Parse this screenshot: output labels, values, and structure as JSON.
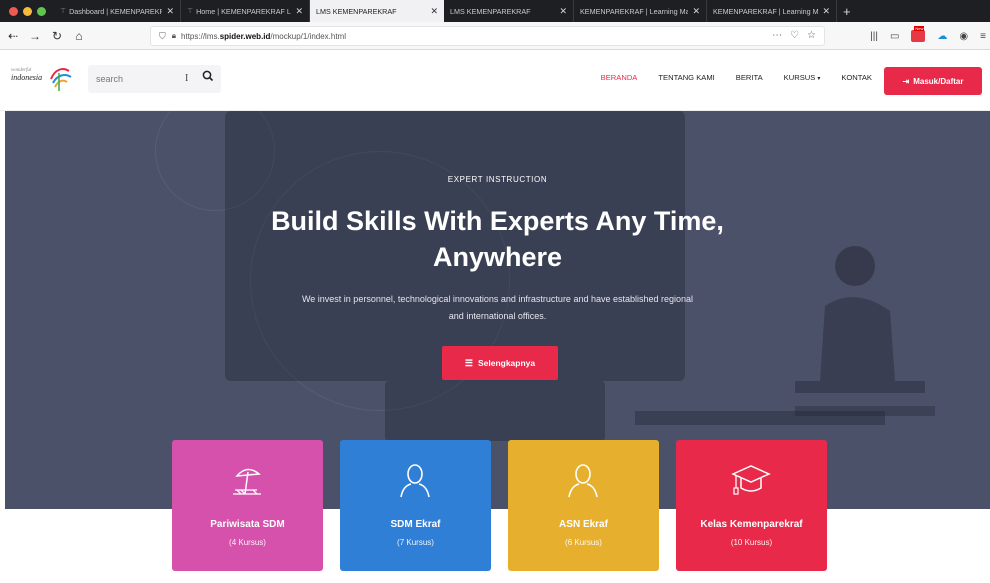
{
  "browser": {
    "tabs": [
      {
        "title": "Dashboard | KEMENPAREKRAF",
        "active": false
      },
      {
        "title": "Home | KEMENPAREKRAF LMS",
        "active": false
      },
      {
        "title": "LMS KEMENPAREKRAF",
        "active": true
      },
      {
        "title": "LMS KEMENPAREKRAF",
        "active": false
      },
      {
        "title": "KEMENPAREKRAF | Learning Mana",
        "active": false
      },
      {
        "title": "KEMENPAREKRAF | Learning Mana",
        "active": false
      }
    ],
    "url_prefix": "https://lms.",
    "url_domain": "spider.web.id",
    "url_path": "/mockup/1/index.html",
    "ext_badge": "New"
  },
  "site": {
    "logo_small": "wonderful",
    "logo_main": "indonesia",
    "search_placeholder": "search",
    "menu": [
      {
        "label": "BERANDA",
        "active": true
      },
      {
        "label": "TENTANG KAMI",
        "active": false
      },
      {
        "label": "BERITA",
        "active": false
      },
      {
        "label": "KURSUS",
        "active": false,
        "dropdown": true
      },
      {
        "label": "KONTAK",
        "active": false
      }
    ],
    "login_label": "Masuk/Daftar"
  },
  "hero": {
    "eyebrow": "EXPERT INSTRUCTION",
    "headline": "Build Skills With Experts Any Time, Anywhere",
    "subtext": "We invest in personnel, technological innovations and infrastructure and have established regional and international offices.",
    "cta_label": "Selengkapnya"
  },
  "categories": [
    {
      "title": "Pariwisata SDM",
      "count": "(4 Kursus)",
      "color": "#d651ac",
      "icon": "beach-umbrella-icon"
    },
    {
      "title": "SDM Ekraf",
      "count": "(7 Kursus)",
      "color": "#2f7fd6",
      "icon": "user-icon"
    },
    {
      "title": "ASN Ekraf",
      "count": "(6 Kursus)",
      "color": "#e6b02e",
      "icon": "user-icon"
    },
    {
      "title": "Kelas Kemenparekraf",
      "count": "(10 Kursus)",
      "color": "#e8294a",
      "icon": "graduation-cap-icon"
    }
  ],
  "colors": {
    "accent": "#e8294a",
    "hero_bg": "#4b5168"
  }
}
